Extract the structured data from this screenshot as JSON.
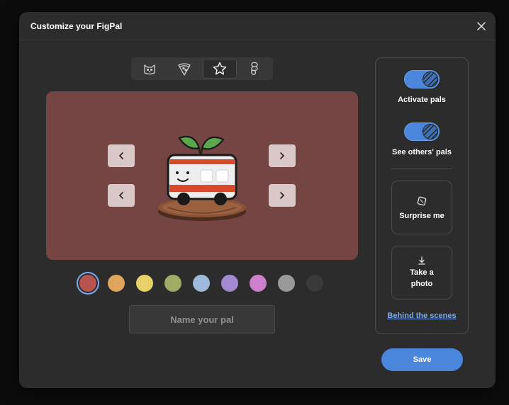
{
  "dialog": {
    "title": "Customize your FigPal"
  },
  "tabs": [
    {
      "icon": "cat-icon",
      "active": false
    },
    {
      "icon": "pizza-icon",
      "active": false
    },
    {
      "icon": "star-icon",
      "active": true
    },
    {
      "icon": "figma-icon",
      "active": false
    }
  ],
  "stage": {
    "background": "#744542",
    "character": "plant-bus"
  },
  "swatches": [
    {
      "color": "#b85450",
      "selected": true
    },
    {
      "color": "#e0a55c",
      "selected": false
    },
    {
      "color": "#e8d06a",
      "selected": false
    },
    {
      "color": "#a1ad67",
      "selected": false
    },
    {
      "color": "#9eb9da",
      "selected": false
    },
    {
      "color": "#a388d2",
      "selected": false
    },
    {
      "color": "#cd7fcb",
      "selected": false
    },
    {
      "color": "#9a9a9a",
      "selected": false
    },
    {
      "color": "#3a3a3a",
      "selected": false
    }
  ],
  "name_input": {
    "placeholder": "Name your pal",
    "value": ""
  },
  "panel": {
    "activate_pals": {
      "label": "Activate pals",
      "on": true
    },
    "see_others": {
      "label": "See others' pals",
      "on": true
    },
    "surprise": {
      "label": "Surprise me",
      "icon": "dice-icon"
    },
    "photo": {
      "label_line1": "Take a",
      "label_line2": "photo",
      "icon": "download-icon"
    },
    "link": "Behind the scenes"
  },
  "footer": {
    "save_label": "Save"
  },
  "colors": {
    "accent": "#4a86dc",
    "link": "#7aaaf0",
    "surface": "#2c2c2c"
  }
}
